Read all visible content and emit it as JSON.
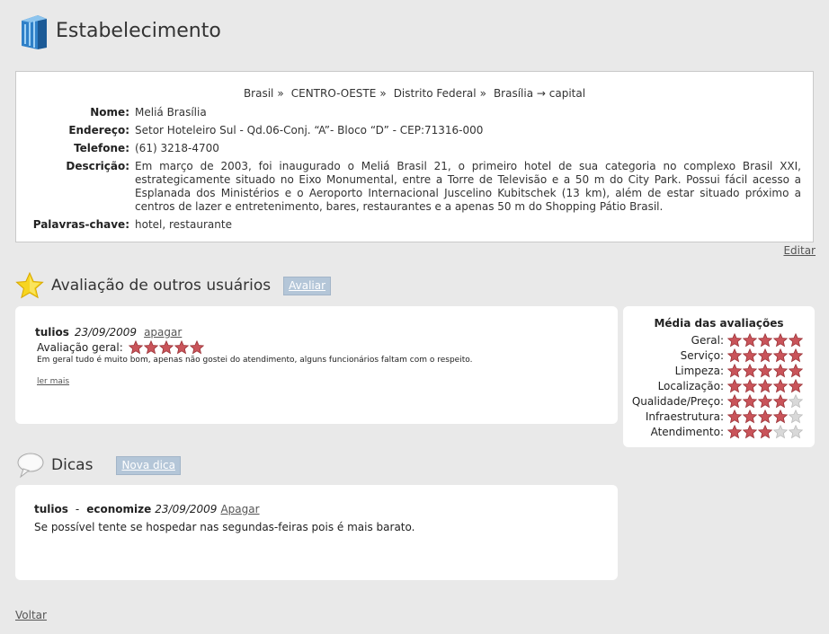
{
  "header": {
    "title": "Estabelecimento",
    "icon": "building-icon"
  },
  "breadcrumb": [
    {
      "label": "Brasil",
      "sep": "»"
    },
    {
      "label": "CENTRO-OESTE",
      "sep": "»"
    },
    {
      "label": "Distrito Federal",
      "sep": "»"
    },
    {
      "label": "Brasília → capital",
      "sep": ""
    }
  ],
  "info": {
    "nome_label": "Nome:",
    "nome": "Meliá Brasília",
    "endereco_label": "Endereço:",
    "endereco": "Setor Hoteleiro Sul - Qd.06-Conj. “A”- Bloco “D” - CEP:71316-000",
    "telefone_label": "Telefone:",
    "telefone": "(61) 3218-4700",
    "descricao_label": "Descrição:",
    "descricao": "Em março de 2003, foi inaugurado o Meliá Brasil 21, o primeiro hotel de sua categoria no complexo Brasil XXI, estrategicamente situado no Eixo Monumental, entre a Torre de Televisão e a 50 m do City Park. Possui fácil acesso a Esplanada dos Ministérios e o Aeroporto Internacional Juscelino Kubitschek (13 km), além de estar situado próximo a centros de lazer e entretenimento, bares, restaurantes e a apenas 50 m do Shopping Pátio Brasil.",
    "palavras_label": "Palavras-chave:",
    "palavras": "hotel, restaurante",
    "edit_label": "Editar"
  },
  "reviews_section": {
    "title": "Avaliação de outros usuários",
    "button": "Avaliar",
    "icon": "star-icon"
  },
  "review": {
    "user": "tulios",
    "date": "23/09/2009",
    "delete_label": "apagar",
    "overall_label": "Avaliação geral:",
    "overall_stars": 5,
    "text": "Em geral tudo é muito bom, apenas não gostei do atendimento, alguns funcionários faltam com o respeito.",
    "read_more": "ler mais"
  },
  "ratings": {
    "title": "Média das avaliações",
    "rows": [
      {
        "label": "Geral:",
        "stars": 5
      },
      {
        "label": "Serviço:",
        "stars": 5
      },
      {
        "label": "Limpeza:",
        "stars": 5
      },
      {
        "label": "Localização:",
        "stars": 5
      },
      {
        "label": "Qualidade/Preço:",
        "stars": 4
      },
      {
        "label": "Infraestrutura:",
        "stars": 4
      },
      {
        "label": "Atendimento:",
        "stars": 3
      }
    ]
  },
  "tips_section": {
    "title": "Dicas",
    "button": "Nova dica",
    "icon": "speech-bubble-icon"
  },
  "tip": {
    "user": "tulios",
    "dash": "-",
    "category": "economize",
    "date": "23/09/2009",
    "delete_label": "Apagar",
    "text": "Se possível tente se hospedar nas segundas-feiras pois é mais barato."
  },
  "footer": {
    "back_label": "Voltar"
  },
  "colors": {
    "star_filled": "#c9545a",
    "star_empty": "#d9d9d9",
    "button_bg": "#b4c6d8"
  }
}
